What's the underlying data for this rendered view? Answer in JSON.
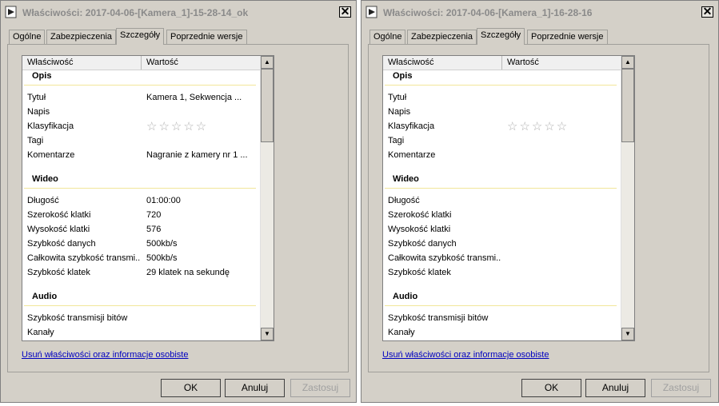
{
  "dialogs": [
    {
      "title": "Właściwości: 2017-04-06-[Kamera_1]-15-28-14_ok",
      "close_glyph": "✕",
      "tabs": [
        "Ogólne",
        "Zabezpieczenia",
        "Szczegóły",
        "Poprzednie wersje"
      ],
      "active_tab": "Szczegóły",
      "columns": {
        "property": "Właściwość",
        "value": "Wartość"
      },
      "groups": {
        "opis": "Opis",
        "wideo": "Wideo",
        "audio": "Audio"
      },
      "rows": {
        "tytul": {
          "label": "Tytuł",
          "value": "Kamera 1, Sekwencja ..."
        },
        "napis": {
          "label": "Napis",
          "value": ""
        },
        "klasyfikacja": {
          "label": "Klasyfikacja",
          "stars": "☆☆☆☆☆"
        },
        "tagi": {
          "label": "Tagi",
          "value": ""
        },
        "komentarze": {
          "label": "Komentarze",
          "value": "Nagranie z kamery nr 1 ..."
        },
        "dlugosc": {
          "label": "Długość",
          "value": "01:00:00"
        },
        "szerokosc": {
          "label": "Szerokość klatki",
          "value": "720"
        },
        "wysokosc": {
          "label": "Wysokość klatki",
          "value": "576"
        },
        "szybkosc_danych": {
          "label": "Szybkość danych",
          "value": "500kb/s"
        },
        "calkowita": {
          "label": "Całkowita szybkość transmi...",
          "value": "500kb/s"
        },
        "szybkosc_klatek": {
          "label": "Szybkość klatek",
          "value": "29 klatek na sekundę"
        },
        "transmisja_bitow": {
          "label": "Szybkość transmisji bitów",
          "value": ""
        },
        "kanaly": {
          "label": "Kanały",
          "value": ""
        }
      },
      "link": "Usuń właściwości oraz informacje osobiste",
      "buttons": {
        "ok": "OK",
        "cancel": "Anuluj",
        "apply": "Zastosuj"
      }
    },
    {
      "title": "Właściwości: 2017-04-06-[Kamera_1]-16-28-16",
      "close_glyph": "✕",
      "tabs": [
        "Ogólne",
        "Zabezpieczenia",
        "Szczegóły",
        "Poprzednie wersje"
      ],
      "active_tab": "Szczegóły",
      "columns": {
        "property": "Właściwość",
        "value": "Wartość"
      },
      "groups": {
        "opis": "Opis",
        "wideo": "Wideo",
        "audio": "Audio"
      },
      "rows": {
        "tytul": {
          "label": "Tytuł",
          "value": ""
        },
        "napis": {
          "label": "Napis",
          "value": ""
        },
        "klasyfikacja": {
          "label": "Klasyfikacja",
          "stars": "☆☆☆☆☆"
        },
        "tagi": {
          "label": "Tagi",
          "value": ""
        },
        "komentarze": {
          "label": "Komentarze",
          "value": ""
        },
        "dlugosc": {
          "label": "Długość",
          "value": ""
        },
        "szerokosc": {
          "label": "Szerokość klatki",
          "value": ""
        },
        "wysokosc": {
          "label": "Wysokość klatki",
          "value": ""
        },
        "szybkosc_danych": {
          "label": "Szybkość danych",
          "value": ""
        },
        "calkowita": {
          "label": "Całkowita szybkość transmi...",
          "value": ""
        },
        "szybkosc_klatek": {
          "label": "Szybkość klatek",
          "value": ""
        },
        "transmisja_bitow": {
          "label": "Szybkość transmisji bitów",
          "value": ""
        },
        "kanaly": {
          "label": "Kanały",
          "value": ""
        }
      },
      "link": "Usuń właściwości oraz informacje osobiste",
      "buttons": {
        "ok": "OK",
        "cancel": "Anuluj",
        "apply": "Zastosuj"
      }
    }
  ]
}
